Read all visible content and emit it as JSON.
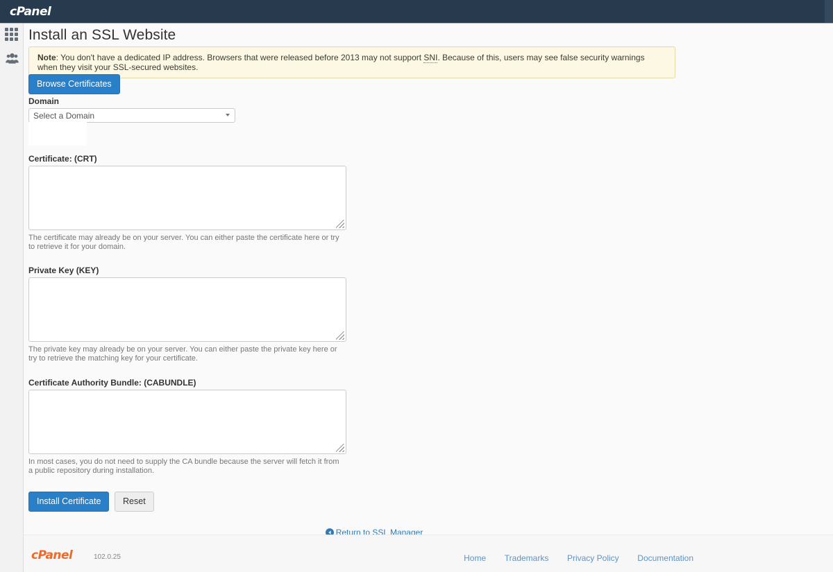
{
  "navbar": {
    "brand": "cPanel"
  },
  "sidebar": {
    "items": [
      {
        "name": "apps-grid",
        "icon": "grid-icon"
      },
      {
        "name": "user-manager",
        "icon": "users-icon"
      }
    ]
  },
  "page": {
    "title": "Install an SSL Website"
  },
  "note": {
    "label": "Note",
    "text_before_abbr": ": You don't have a dedicated IP address. Browsers that were released before 2013 may not support ",
    "abbr": "SNI",
    "text_after_abbr": ". Because of this, users may see false security warnings when they visit your SSL-secured websites."
  },
  "browse": {
    "label": "Browse Certificates"
  },
  "domain": {
    "label": "Domain",
    "selected": "Select a Domain",
    "options": [
      "Select a Domain"
    ]
  },
  "certificate": {
    "label": "Certificate: (CRT)",
    "value": "",
    "help": "The certificate may already be on your server. You can either paste the certificate here or try to retrieve it for your domain."
  },
  "private_key": {
    "label": "Private Key (KEY)",
    "value": "",
    "help": "The private key may already be on your server. You can either paste the private key here or try to retrieve the matching key for your certificate."
  },
  "ca_bundle": {
    "label": "Certificate Authority Bundle: (CABUNDLE)",
    "value": "",
    "help": "In most cases, you do not need to supply the CA bundle because the server will fetch it from a public repository during installation."
  },
  "actions": {
    "install_label": "Install Certificate",
    "reset_label": "Reset"
  },
  "return_link": {
    "label": "Return to SSL Manager",
    "icon": "arrow-circle-left-icon"
  },
  "footer": {
    "brand": "cPanel",
    "version": "102.0.25",
    "links": [
      {
        "label": "Home"
      },
      {
        "label": "Trademarks"
      },
      {
        "label": "Privacy Policy"
      },
      {
        "label": "Documentation"
      }
    ]
  },
  "colors": {
    "navbar_bg": "#283a4d",
    "primary_button": "#2a7fc9",
    "note_bg": "#fcf8e3",
    "brand_orange": "#ef6a28",
    "link_blue": "#337ab7"
  }
}
